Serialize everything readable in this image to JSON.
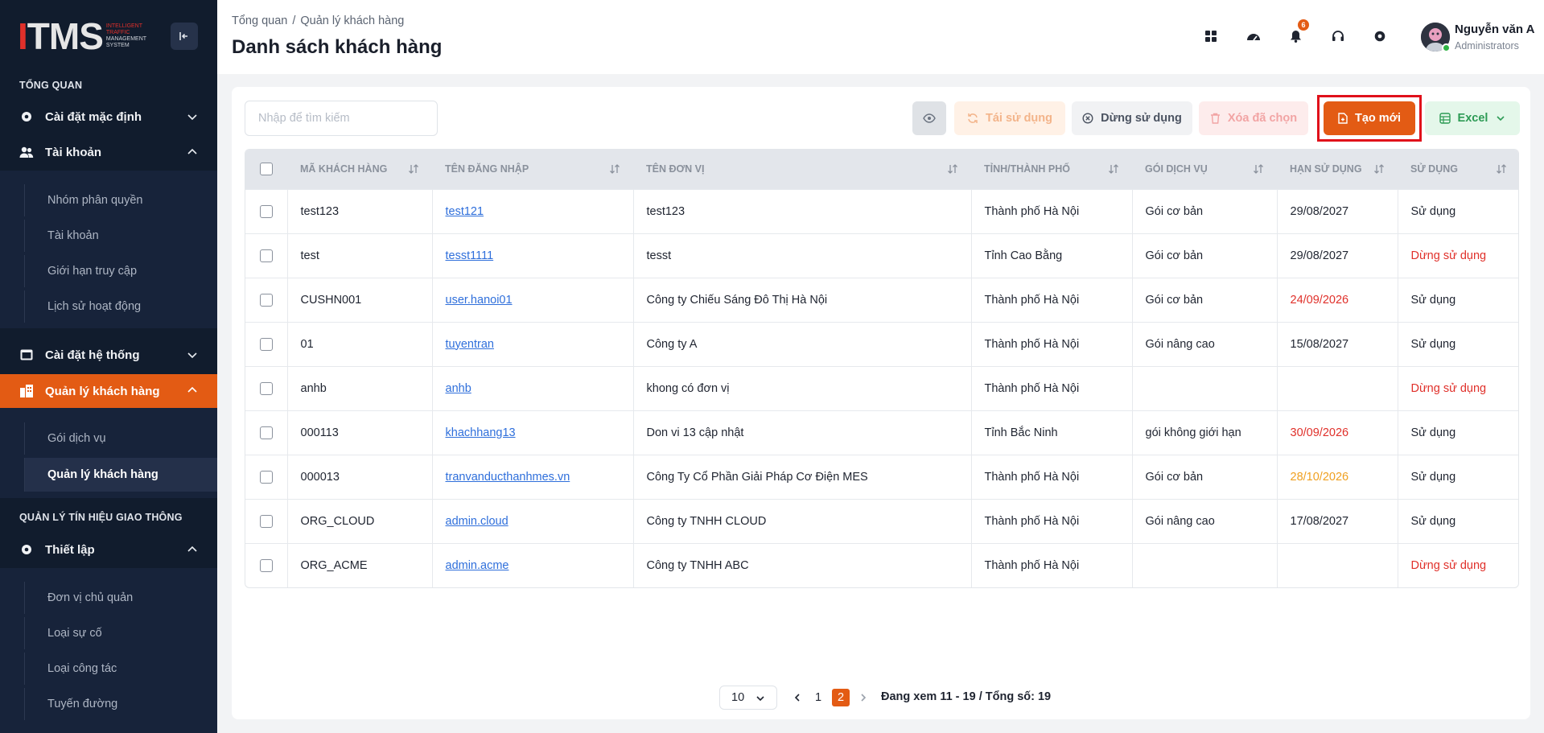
{
  "sidebar": {
    "logo": {
      "mark": "ITMS",
      "sub1": "INTELLIGENT",
      "sub2": "TRAFFIC",
      "sub3": "MANAGEMENT",
      "sub4": "SYSTEM"
    },
    "section_overview": "TỔNG QUAN",
    "default_settings": "Cài đặt mặc định",
    "accounts": "Tài khoản",
    "accounts_sub": [
      "Nhóm phân quyền",
      "Tài khoản",
      "Giới hạn truy cập",
      "Lịch sử hoạt động"
    ],
    "system_settings": "Cài đặt hệ thống",
    "customer_mgmt": "Quản lý khách hàng",
    "customer_sub": [
      "Gói dịch vụ",
      "Quản lý khách hàng"
    ],
    "section_traffic": "QUẢN LÝ TÍN HIỆU GIAO THÔNG",
    "setup": "Thiết lập",
    "setup_sub": [
      "Đơn vị chủ quản",
      "Loại sự cố",
      "Loại công tác",
      "Tuyến đường"
    ]
  },
  "header": {
    "breadcrumb_root": "Tổng quan",
    "breadcrumb_sep": "/",
    "breadcrumb_current": "Quản lý khách hàng",
    "title": "Danh sách khách hàng",
    "notif_count": "6",
    "user_name": "Nguyễn văn A",
    "user_role": "Administrators"
  },
  "toolbar": {
    "search_placeholder": "Nhập để tìm kiếm",
    "reuse": "Tái sử dụng",
    "stop": "Dừng sử dụng",
    "delete": "Xóa đã chọn",
    "create": "Tạo mới",
    "excel": "Excel"
  },
  "table": {
    "columns": [
      "MÃ KHÁCH HÀNG",
      "TÊN ĐĂNG NHẬP",
      "TÊN ĐƠN VỊ",
      "TỈNH/THÀNH PHỐ",
      "GÓI DỊCH VỤ",
      "HẠN SỬ DỤNG",
      "SỬ DỤNG"
    ],
    "rows": [
      {
        "code": "test123",
        "username": "test121",
        "unit": "test123",
        "city": "Thành phố Hà Nội",
        "plan": "Gói cơ bản",
        "expiry": "29/08/2027",
        "expiry_color": "",
        "status": "Sử dụng",
        "status_color": ""
      },
      {
        "code": "test",
        "username": "tesst1111",
        "unit": "tesst",
        "city": "Tỉnh Cao Bằng",
        "plan": "Gói cơ bản",
        "expiry": "29/08/2027",
        "expiry_color": "",
        "status": "Dừng sử dụng",
        "status_color": "red"
      },
      {
        "code": "CUSHN001",
        "username": "user.hanoi01",
        "unit": "Công ty Chiếu Sáng Đô Thị Hà Nội",
        "city": "Thành phố Hà Nội",
        "plan": "Gói cơ bản",
        "expiry": "24/09/2026",
        "expiry_color": "red",
        "status": "Sử dụng",
        "status_color": ""
      },
      {
        "code": "01",
        "username": "tuyentran",
        "unit": "Công ty A",
        "city": "Thành phố Hà Nội",
        "plan": "Gói nâng cao",
        "expiry": "15/08/2027",
        "expiry_color": "",
        "status": "Sử dụng",
        "status_color": ""
      },
      {
        "code": "anhb",
        "username": "anhb",
        "unit": "khong có đơn vị",
        "city": "Thành phố Hà Nội",
        "plan": "",
        "expiry": "",
        "expiry_color": "",
        "status": "Dừng sử dụng",
        "status_color": "red"
      },
      {
        "code": "000113",
        "username": "khachhang13",
        "unit": "Don vi 13 cập nhật",
        "city": "Tỉnh Bắc Ninh",
        "plan": "gói không giới hạn",
        "expiry": "30/09/2026",
        "expiry_color": "red",
        "status": "Sử dụng",
        "status_color": ""
      },
      {
        "code": "000013",
        "username": "tranvanducthanhmes.vn",
        "unit": "Công Ty Cổ Phần Giải Pháp Cơ Điện MES",
        "city": "Thành phố Hà Nội",
        "plan": "Gói cơ bản",
        "expiry": "28/10/2026",
        "expiry_color": "orange",
        "status": "Sử dụng",
        "status_color": ""
      },
      {
        "code": "ORG_CLOUD",
        "username": "admin.cloud",
        "unit": "Công ty TNHH CLOUD",
        "city": "Thành phố Hà Nội",
        "plan": "Gói nâng cao",
        "expiry": "17/08/2027",
        "expiry_color": "",
        "status": "Sử dụng",
        "status_color": ""
      },
      {
        "code": "ORG_ACME",
        "username": "admin.acme",
        "unit": "Công ty TNHH ABC",
        "city": "Thành phố Hà Nội",
        "plan": "",
        "expiry": "",
        "expiry_color": "",
        "status": "Dừng sử dụng",
        "status_color": "red"
      }
    ]
  },
  "pagination": {
    "page_size": "10",
    "pages": [
      "1",
      "2"
    ],
    "current": "2",
    "info": "Đang xem 11 - 19 / Tổng số: 19"
  },
  "colors": {
    "accent": "#e35b14",
    "sidebar_bg": "#111c2d",
    "danger": "#e0302a",
    "warning": "#f0a020",
    "link": "#2f6fdb"
  }
}
